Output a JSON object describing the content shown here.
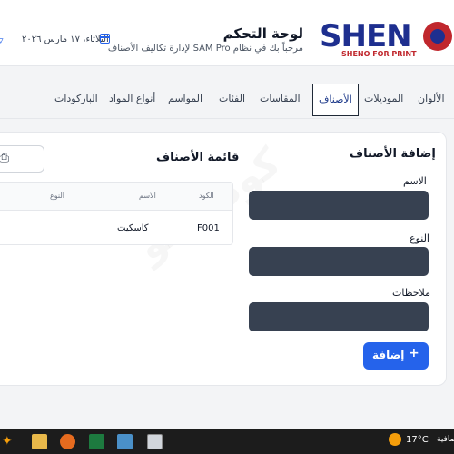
{
  "header": {
    "logo_text": "SHEN",
    "logo_sub": "SHENO FOR PRINT",
    "title": "لوحة التحكم",
    "subtitle": "مرحباً بك في نظام SAM Pro لإدارة تكاليف الأصناف",
    "date": "الثلاثاء، ١٧ مارس ٢٠٢٦"
  },
  "tabs": [
    {
      "label": "الألوان",
      "active": false
    },
    {
      "label": "الموديلات",
      "active": false
    },
    {
      "label": "الأصناف",
      "active": true
    },
    {
      "label": "المقاسات",
      "active": false
    },
    {
      "label": "الفئات",
      "active": false
    },
    {
      "label": "المواسم",
      "active": false
    },
    {
      "label": "أنواع المواد",
      "active": false
    },
    {
      "label": "الباركودات",
      "active": false
    }
  ],
  "form": {
    "title": "إضافة الأصناف",
    "name_label": "الاسم",
    "name_value": "",
    "type_label": "النوع",
    "type_value": "",
    "notes_label": "ملاحظات",
    "notes_value": "",
    "add_button": "إضافة"
  },
  "list": {
    "title": "قائمة الأصناف",
    "columns": [
      "الكود",
      "الاسم",
      "النوع"
    ],
    "rows": [
      {
        "code": "F001",
        "name": "كاسكيت",
        "type": ""
      }
    ]
  },
  "watermark": "كود شنو",
  "taskbar": {
    "temperature": "17°C",
    "weather": "صافية"
  },
  "colors": {
    "brand_blue": "#1e2f8f",
    "brand_red": "#c0272d",
    "primary_button": "#2563eb",
    "input_bg": "#374151"
  }
}
